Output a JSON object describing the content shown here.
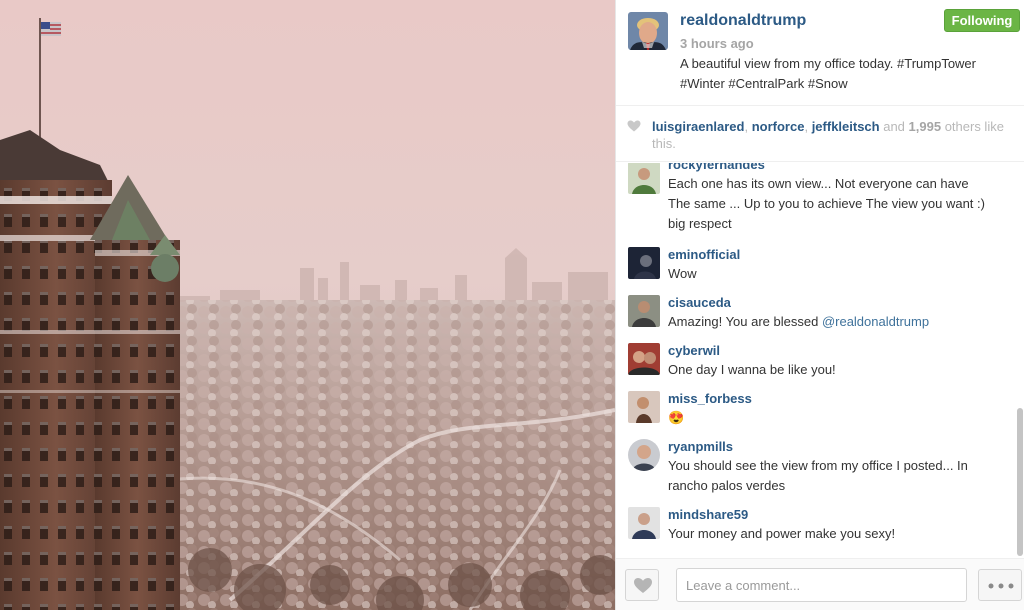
{
  "photo": {
    "alt_icon": "photo-central-park-winter"
  },
  "header": {
    "username": "realdonaldtrump",
    "follow_label": "Following",
    "timestamp": "3 hours ago",
    "caption_line1": "A beautiful view from my office today. #TrumpTower",
    "caption_line2": "#Winter #CentralPark #Snow"
  },
  "likes": {
    "user1": "luisgiraenlared",
    "user2": "norforce",
    "user3": "jeffkleitsch",
    "and_text": " and ",
    "count": "1,995",
    "suffix": " others like this."
  },
  "comments": [
    {
      "user": "rockyfernandes",
      "text_line1": "Each one has its own view... Not everyone can have",
      "text_line2": "The same ... Up to you to achieve The view you want :)",
      "text_line3": "big respect"
    },
    {
      "user": "eminofficial",
      "text_line1": "Wow"
    },
    {
      "user": "cisauceda",
      "text_line1": "Amazing! You are blessed ",
      "mention": "@realdonaldtrump"
    },
    {
      "user": "cyberwil",
      "text_line1": "One day I wanna be like you!"
    },
    {
      "user": "miss_forbess",
      "text_line1": "😍"
    },
    {
      "user": "ryanpmills",
      "text_line1": "You should see the view from my office I posted... In",
      "text_line2": "rancho palos verdes"
    },
    {
      "user": "mindshare59",
      "text_line1": "Your money and power make you sexy!"
    }
  ],
  "footer": {
    "comment_placeholder": "Leave a comment...",
    "like_icon": "heart-icon",
    "more_icon": "more-dots-icon"
  },
  "colors": {
    "username": "#2c5a85",
    "follow_green": "#6bb545",
    "text": "#333333",
    "muted": "#a5a5a5"
  }
}
